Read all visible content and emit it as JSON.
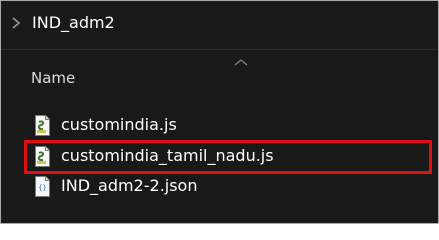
{
  "breadcrumb": {
    "folder": "IND_adm2"
  },
  "column_header": {
    "name_label": "Name"
  },
  "files": [
    {
      "name": "customindia.js",
      "icon": "js-file-icon"
    },
    {
      "name": "customindia_tamil_nadu.js",
      "icon": "js-file-icon",
      "highlighted": true
    },
    {
      "name": "IND_adm2-2.json",
      "icon": "json-file-icon"
    }
  ],
  "colors": {
    "background": "#191919",
    "text": "#ffffff",
    "highlight_border": "#e01010"
  }
}
